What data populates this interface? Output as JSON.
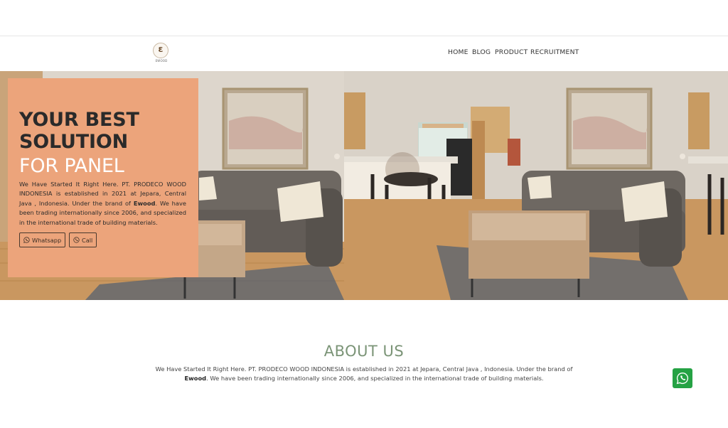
{
  "brand": {
    "logo_text": "EWOOD"
  },
  "nav": {
    "items": [
      "HOME",
      "BLOG",
      "PRODUCT",
      "RECRUITMENT"
    ],
    "active_index": 0
  },
  "hero": {
    "title_line1": "YOUR BEST",
    "title_line2": "SOLUTION",
    "subtitle": "FOR PANEL",
    "intro_before_brand": "We Have Started It Right Here. PT. PRODECO WOOD INDONESIA is established in 2021 at Jepara, Central Java , Indonesia. Under the brand of ",
    "brand_name": "Ewood",
    "intro_after_brand": ". We have been trading internationally since 2006, and specialized in the international trade of building materials.",
    "whatsapp_label": "Whatsapp",
    "call_label": "Call"
  },
  "about": {
    "title": "ABOUT US",
    "text_before_brand": "We Have Started It Right Here. PT. PRODECO WOOD INDONESIA is established in 2021 at Jepara, Central Java , Indonesia. Under the brand of ",
    "brand_name": "Ewood",
    "text_after_brand": ". We have been trading internationally since 2006, and specialized in the international trade of building materials."
  },
  "colors": {
    "accent": "#d98a45",
    "hero_card": "#eca47b",
    "about_title": "#7b9477",
    "whatsapp": "#25a244"
  }
}
